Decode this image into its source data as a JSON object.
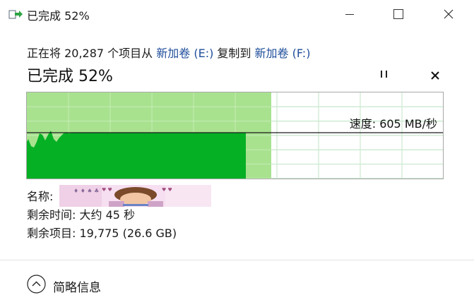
{
  "window": {
    "title": "已完成 52%",
    "icon": "file-copy-icon",
    "controls": [
      "minimize-icon",
      "maximize-icon",
      "close-icon"
    ]
  },
  "copy": {
    "prefix": "正在将 20,287 个项目从 ",
    "source": "新加卷 (E:)",
    "middle": " 复制到 ",
    "dest": "新加卷 (F:)"
  },
  "progress": {
    "status": "已完成 52%",
    "percent": 52,
    "speed": "速度: 605 MB/秒",
    "colors": {
      "done": "#a8e28f",
      "throughput": "#06b025",
      "grid": "#9fd8a8"
    }
  },
  "details": {
    "name_label": "名称:",
    "remaining_time_label": "剩余时间:",
    "remaining_time_value": "大约 45 秒",
    "remaining_items_label": "剩余项目:",
    "remaining_items_value": "19,775 (26.6 GB)"
  },
  "footer": {
    "toggle_label": "简略信息",
    "icon": "chevron-up-icon"
  }
}
